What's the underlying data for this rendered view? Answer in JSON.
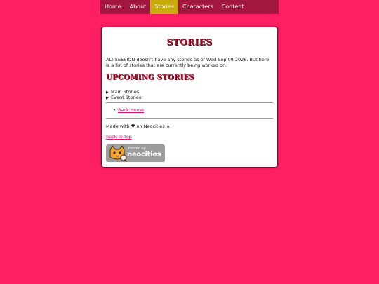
{
  "nav": {
    "items": [
      "Home",
      "About",
      "Stories",
      "Characters",
      "Content"
    ],
    "active_index": 2
  },
  "page": {
    "title": "STORIES",
    "intro": "ALT-SESSION doesn't have any stories as of Wed Sep 09 2026. But here is a list of stories that are currently being worked on.",
    "upcoming_heading": "UPCOMING STORIES",
    "details": [
      "Main Stories",
      "Event Stories"
    ],
    "back_home": "Back Home",
    "made_with": "Made with ♥ on Neocities ★",
    "back_to_top": "back to top",
    "badge": {
      "line1": "hosted by",
      "line2": "neocities"
    }
  },
  "colors": {
    "background": "#fe1e62",
    "nav": "#a2173f",
    "nav_active": "#c9aa0c",
    "heading": "#a8102b",
    "link": "#e0156a"
  }
}
